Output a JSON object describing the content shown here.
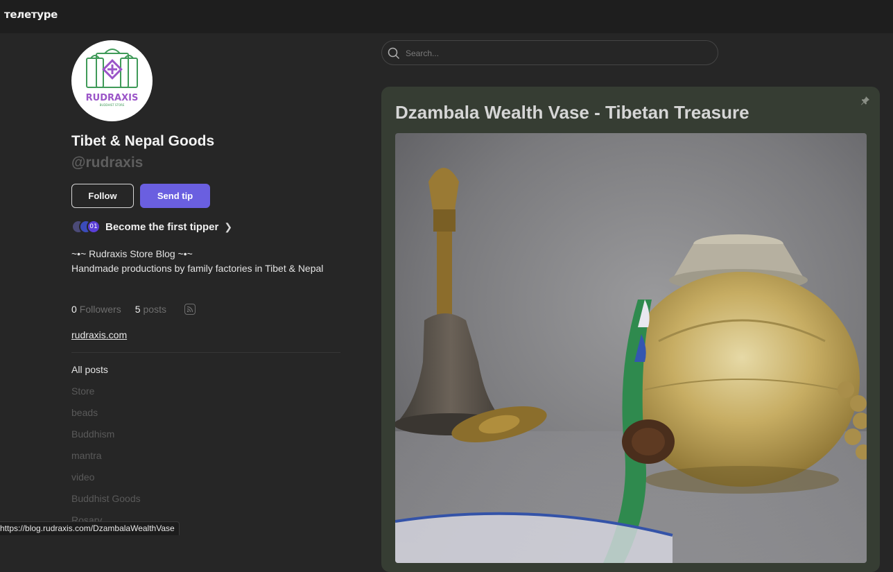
{
  "app": {
    "logo_text": "тeлeтype"
  },
  "profile": {
    "avatar_text": "RUDRAXIS",
    "avatar_subtext": "BUDDHIST STORE",
    "name": "Tibet & Nepal Goods",
    "handle": "@rudraxis",
    "follow_label": "Follow",
    "tip_label": "Send tip",
    "tipper_coin_label": "01",
    "tipper_text": "Become the first tipper",
    "description_line1": "~•~ Rudraxis Store Blog ~•~",
    "description_line2": "Handmade productions by family factories in Tibet & Nepal",
    "followers_count": "0",
    "followers_label": "Followers",
    "posts_count": "5",
    "posts_label": "posts",
    "website": "rudraxis.com"
  },
  "tags": [
    "All posts",
    "Store",
    "beads",
    "Buddhism",
    "mantra",
    "video",
    "Buddhist Goods",
    "Rosary"
  ],
  "search": {
    "placeholder": "Search..."
  },
  "post": {
    "title": "Dzambala Wealth Vase - Tibetan Treasure"
  },
  "status_bar": {
    "url": "https://blog.rudraxis.com/DzambalaWealthVase"
  },
  "colors": {
    "accent": "#6a5fe0",
    "card_bg": "#363d33",
    "page_bg": "#262626"
  }
}
